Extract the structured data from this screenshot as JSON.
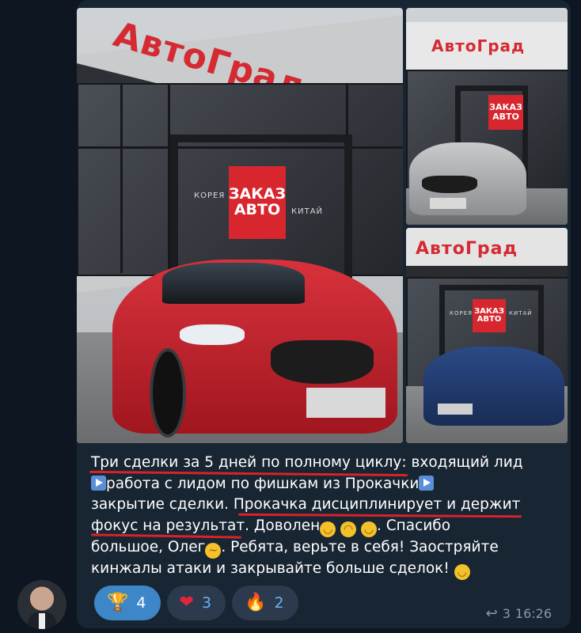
{
  "post": {
    "photos": [
      {
        "name": "dealership-red-mazda",
        "brand": "АвтоГрад",
        "banner": [
          "ЗАКАЗ",
          "АВТО"
        ],
        "side_left": "КОРЕЯ",
        "side_right": "КИТАЙ"
      },
      {
        "name": "dealership-silver-vw",
        "brand": "АвтоГрад",
        "banner": [
          "ЗАКАЗ",
          "АВТО"
        ]
      },
      {
        "name": "dealership-blue-sedan",
        "brand": "АвтоГрад",
        "banner": [
          "ЗАКАЗ",
          "АВТО"
        ],
        "side_left": "КОРЕЯ",
        "side_right": "КИТАЙ"
      }
    ],
    "text": {
      "l1a": "Три сделки за 5 дней по полному циклу",
      "l1b": ": входящий лид",
      "l2": "работа с лидом по фишкам из Прокачки",
      "l3a": "закрытие сделки. ",
      "l3b": "Прокачка дисциплинирует и держит",
      "l4a": "фокус на результат",
      "l4b": ". Доволен",
      "l4c": ". Спасибо",
      "l5a": "большое, Олег",
      "l5b": ". Ребята, верьте в себя! Заостряйте",
      "l6": "кинжалы атаки и закрывайте больше сделок! "
    },
    "reactions": [
      {
        "icon": "trophy-icon",
        "glyph": "🏆",
        "count": "4",
        "active": true
      },
      {
        "icon": "heart-icon",
        "glyph": "❤",
        "count": "3",
        "active": false
      },
      {
        "icon": "fire-icon",
        "glyph": "🔥",
        "count": "2",
        "active": false
      }
    ],
    "meta": {
      "replies": "3",
      "time": "16:26"
    },
    "colors": {
      "accent": "#3d87c9",
      "underline": "#d8232a",
      "bubble": "#182533",
      "bg": "#0e1621"
    }
  }
}
